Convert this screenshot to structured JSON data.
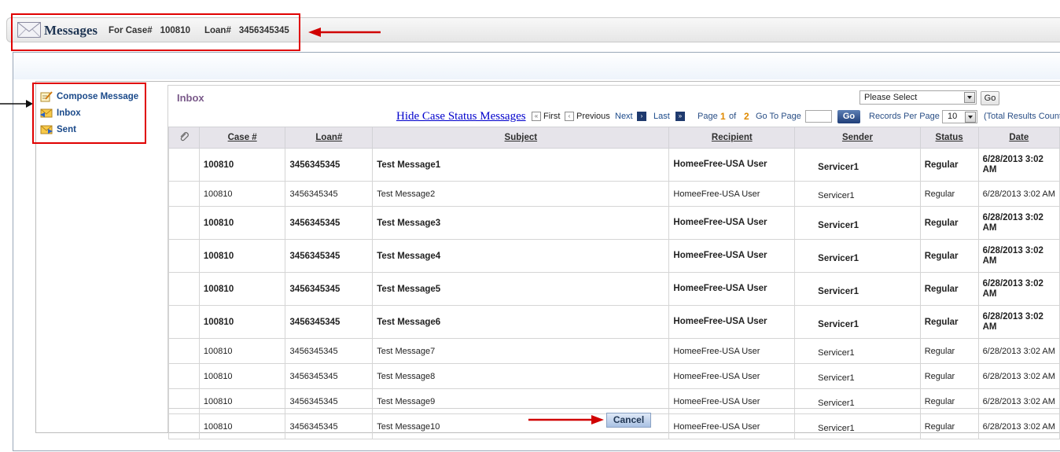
{
  "header": {
    "title": "Messages",
    "case_label": "For Case#",
    "case_value": "100810",
    "loan_label": "Loan#",
    "loan_value": "3456345345"
  },
  "nav": {
    "items": [
      {
        "label": "Compose Message",
        "icon": "compose-icon"
      },
      {
        "label": "Inbox",
        "icon": "inbox-icon"
      },
      {
        "label": "Sent",
        "icon": "sent-icon"
      }
    ]
  },
  "inbox": {
    "title": "Inbox",
    "filter_selected": "Please Select",
    "filter_go": "Go",
    "hide_link": "Hide Case Status Messages",
    "first": "First",
    "previous": "Previous",
    "next": "Next",
    "last": "Last",
    "page_label": "Page",
    "page_current": "1",
    "of_label": "of",
    "page_total": "2",
    "goto_label": "Go To Page",
    "goto_go": "Go",
    "rpp_label": "Records Per Page",
    "rpp_value": "10",
    "total_label": "(Total Results Count"
  },
  "table": {
    "columns": [
      "Case #",
      "Loan#",
      "Subject",
      "Recipient",
      "Sender",
      "Status",
      "Date"
    ],
    "rows": [
      {
        "unread": true,
        "case": "100810",
        "loan": "3456345345",
        "subject": "Test Message1",
        "recipient": "HomeeFree-USA User",
        "sender": "Servicer1",
        "status": "Regular",
        "date": "6/28/2013 3:02 AM"
      },
      {
        "unread": false,
        "case": "100810",
        "loan": "3456345345",
        "subject": "Test Message2",
        "recipient": "HomeeFree-USA User",
        "sender": "Servicer1",
        "status": "Regular",
        "date": "6/28/2013 3:02 AM"
      },
      {
        "unread": true,
        "case": "100810",
        "loan": "3456345345",
        "subject": "Test Message3",
        "recipient": "HomeeFree-USA User",
        "sender": "Servicer1",
        "status": "Regular",
        "date": "6/28/2013 3:02 AM"
      },
      {
        "unread": true,
        "case": "100810",
        "loan": "3456345345",
        "subject": "Test Message4",
        "recipient": "HomeeFree-USA User",
        "sender": "Servicer1",
        "status": "Regular",
        "date": "6/28/2013 3:02 AM"
      },
      {
        "unread": true,
        "case": "100810",
        "loan": "3456345345",
        "subject": "Test Message5",
        "recipient": "HomeeFree-USA User",
        "sender": "Servicer1",
        "status": "Regular",
        "date": "6/28/2013 3:02 AM"
      },
      {
        "unread": true,
        "case": "100810",
        "loan": "3456345345",
        "subject": "Test Message6",
        "recipient": "HomeeFree-USA User",
        "sender": "Servicer1",
        "status": "Regular",
        "date": "6/28/2013 3:02 AM"
      },
      {
        "unread": false,
        "case": "100810",
        "loan": "3456345345",
        "subject": "Test Message7",
        "recipient": "HomeeFree-USA User",
        "sender": "Servicer1",
        "status": "Regular",
        "date": "6/28/2013 3:02 AM"
      },
      {
        "unread": false,
        "case": "100810",
        "loan": "3456345345",
        "subject": "Test Message8",
        "recipient": "HomeeFree-USA User",
        "sender": "Servicer1",
        "status": "Regular",
        "date": "6/28/2013 3:02 AM"
      },
      {
        "unread": false,
        "case": "100810",
        "loan": "3456345345",
        "subject": "Test Message9",
        "recipient": "HomeeFree-USA User",
        "sender": "Servicer1",
        "status": "Regular",
        "date": "6/28/2013 3:02 AM"
      },
      {
        "unread": false,
        "case": "100810",
        "loan": "3456345345",
        "subject": "Test Message10",
        "recipient": "HomeeFree-USA User",
        "sender": "Servicer1",
        "status": "Regular",
        "date": "6/28/2013 3:02 AM"
      }
    ]
  },
  "footer": {
    "cancel": "Cancel"
  },
  "colors": {
    "annotation": "#e00000",
    "link": "#0000cc",
    "page_accent": "#e08a00",
    "header_bg": "#e6e4ea"
  }
}
